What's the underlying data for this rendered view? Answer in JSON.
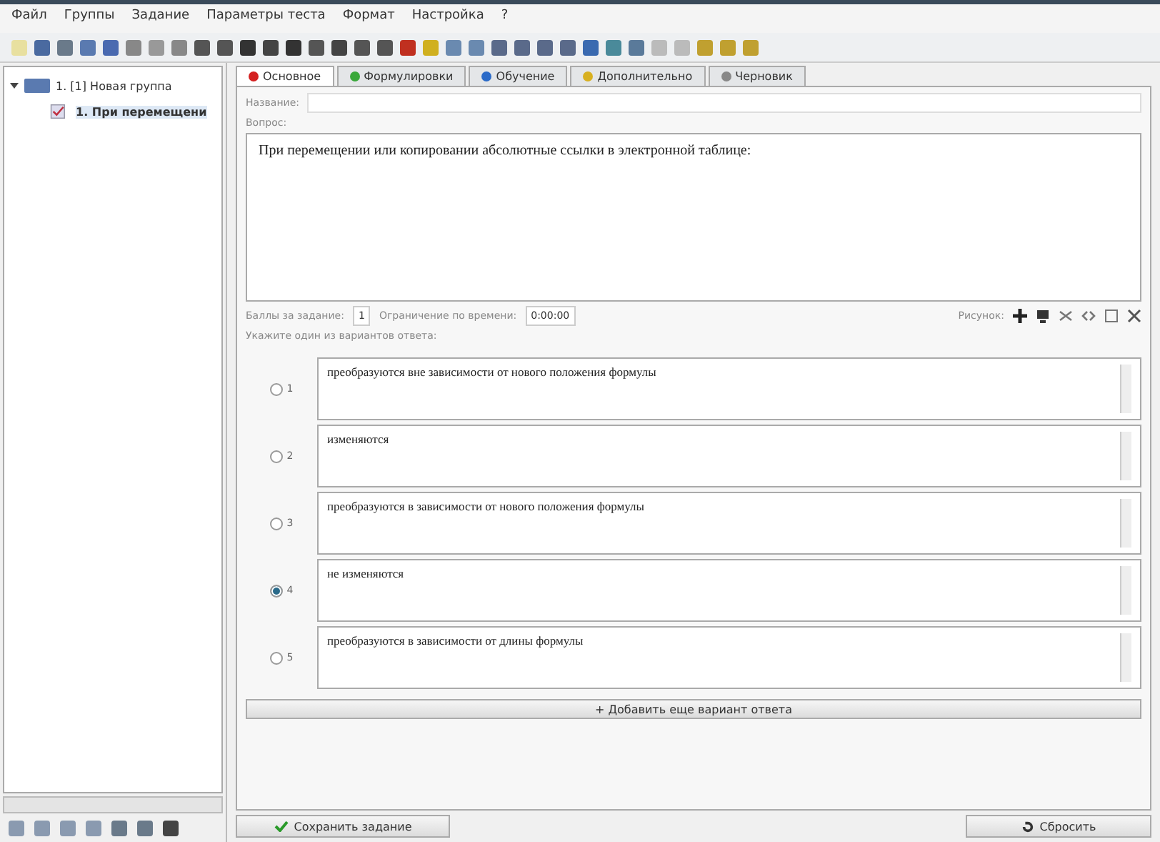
{
  "menu": [
    "Файл",
    "Группы",
    "Задание",
    "Параметры теста",
    "Формат",
    "Настройка",
    "?"
  ],
  "tree": [
    {
      "label": "1. [1] Новая группа",
      "expanded": true,
      "children": [
        {
          "label": "1. При перемещени",
          "selected": true
        }
      ]
    }
  ],
  "tabs": [
    {
      "label": "Основное",
      "selected": true,
      "color": "#d42020"
    },
    {
      "label": "Формулировки",
      "selected": false,
      "color": "#3aa83a"
    },
    {
      "label": "Обучение",
      "selected": false,
      "color": "#2a6ac8"
    },
    {
      "label": "Дополнительно",
      "selected": false,
      "color": "#d8b020"
    },
    {
      "label": "Черновик",
      "selected": false,
      "color": "#888888"
    }
  ],
  "name_field": {
    "label": "Название:"
  },
  "question": {
    "label": "Вопрос:",
    "text": "При перемещении или копировании абсолютные ссылки в электронной таблице:"
  },
  "score": {
    "label": "Баллы за задание:",
    "value": "1"
  },
  "time_limit": {
    "label": "Ограничение по времени:",
    "value": "0:00:00"
  },
  "picture_label": "Рисунок:",
  "answers_hint": "Укажите один из вариантов ответа:",
  "answers": [
    {
      "number": "1",
      "text": "преобразуются вне зависимости от нового положения формулы",
      "selected": false
    },
    {
      "number": "2",
      "text": "изменяются",
      "selected": false
    },
    {
      "number": "3",
      "text": "преобразуются в зависимости от нового положения формулы",
      "selected": false
    },
    {
      "number": "4",
      "text": "не изменяются",
      "selected": true
    },
    {
      "number": "5",
      "text": "преобразуются в зависимости от длины формулы",
      "selected": false
    }
  ],
  "add_answer": "+ Добавить еще вариант ответа",
  "save_button": "Сохранить задание",
  "reset_button": "Сбросить"
}
